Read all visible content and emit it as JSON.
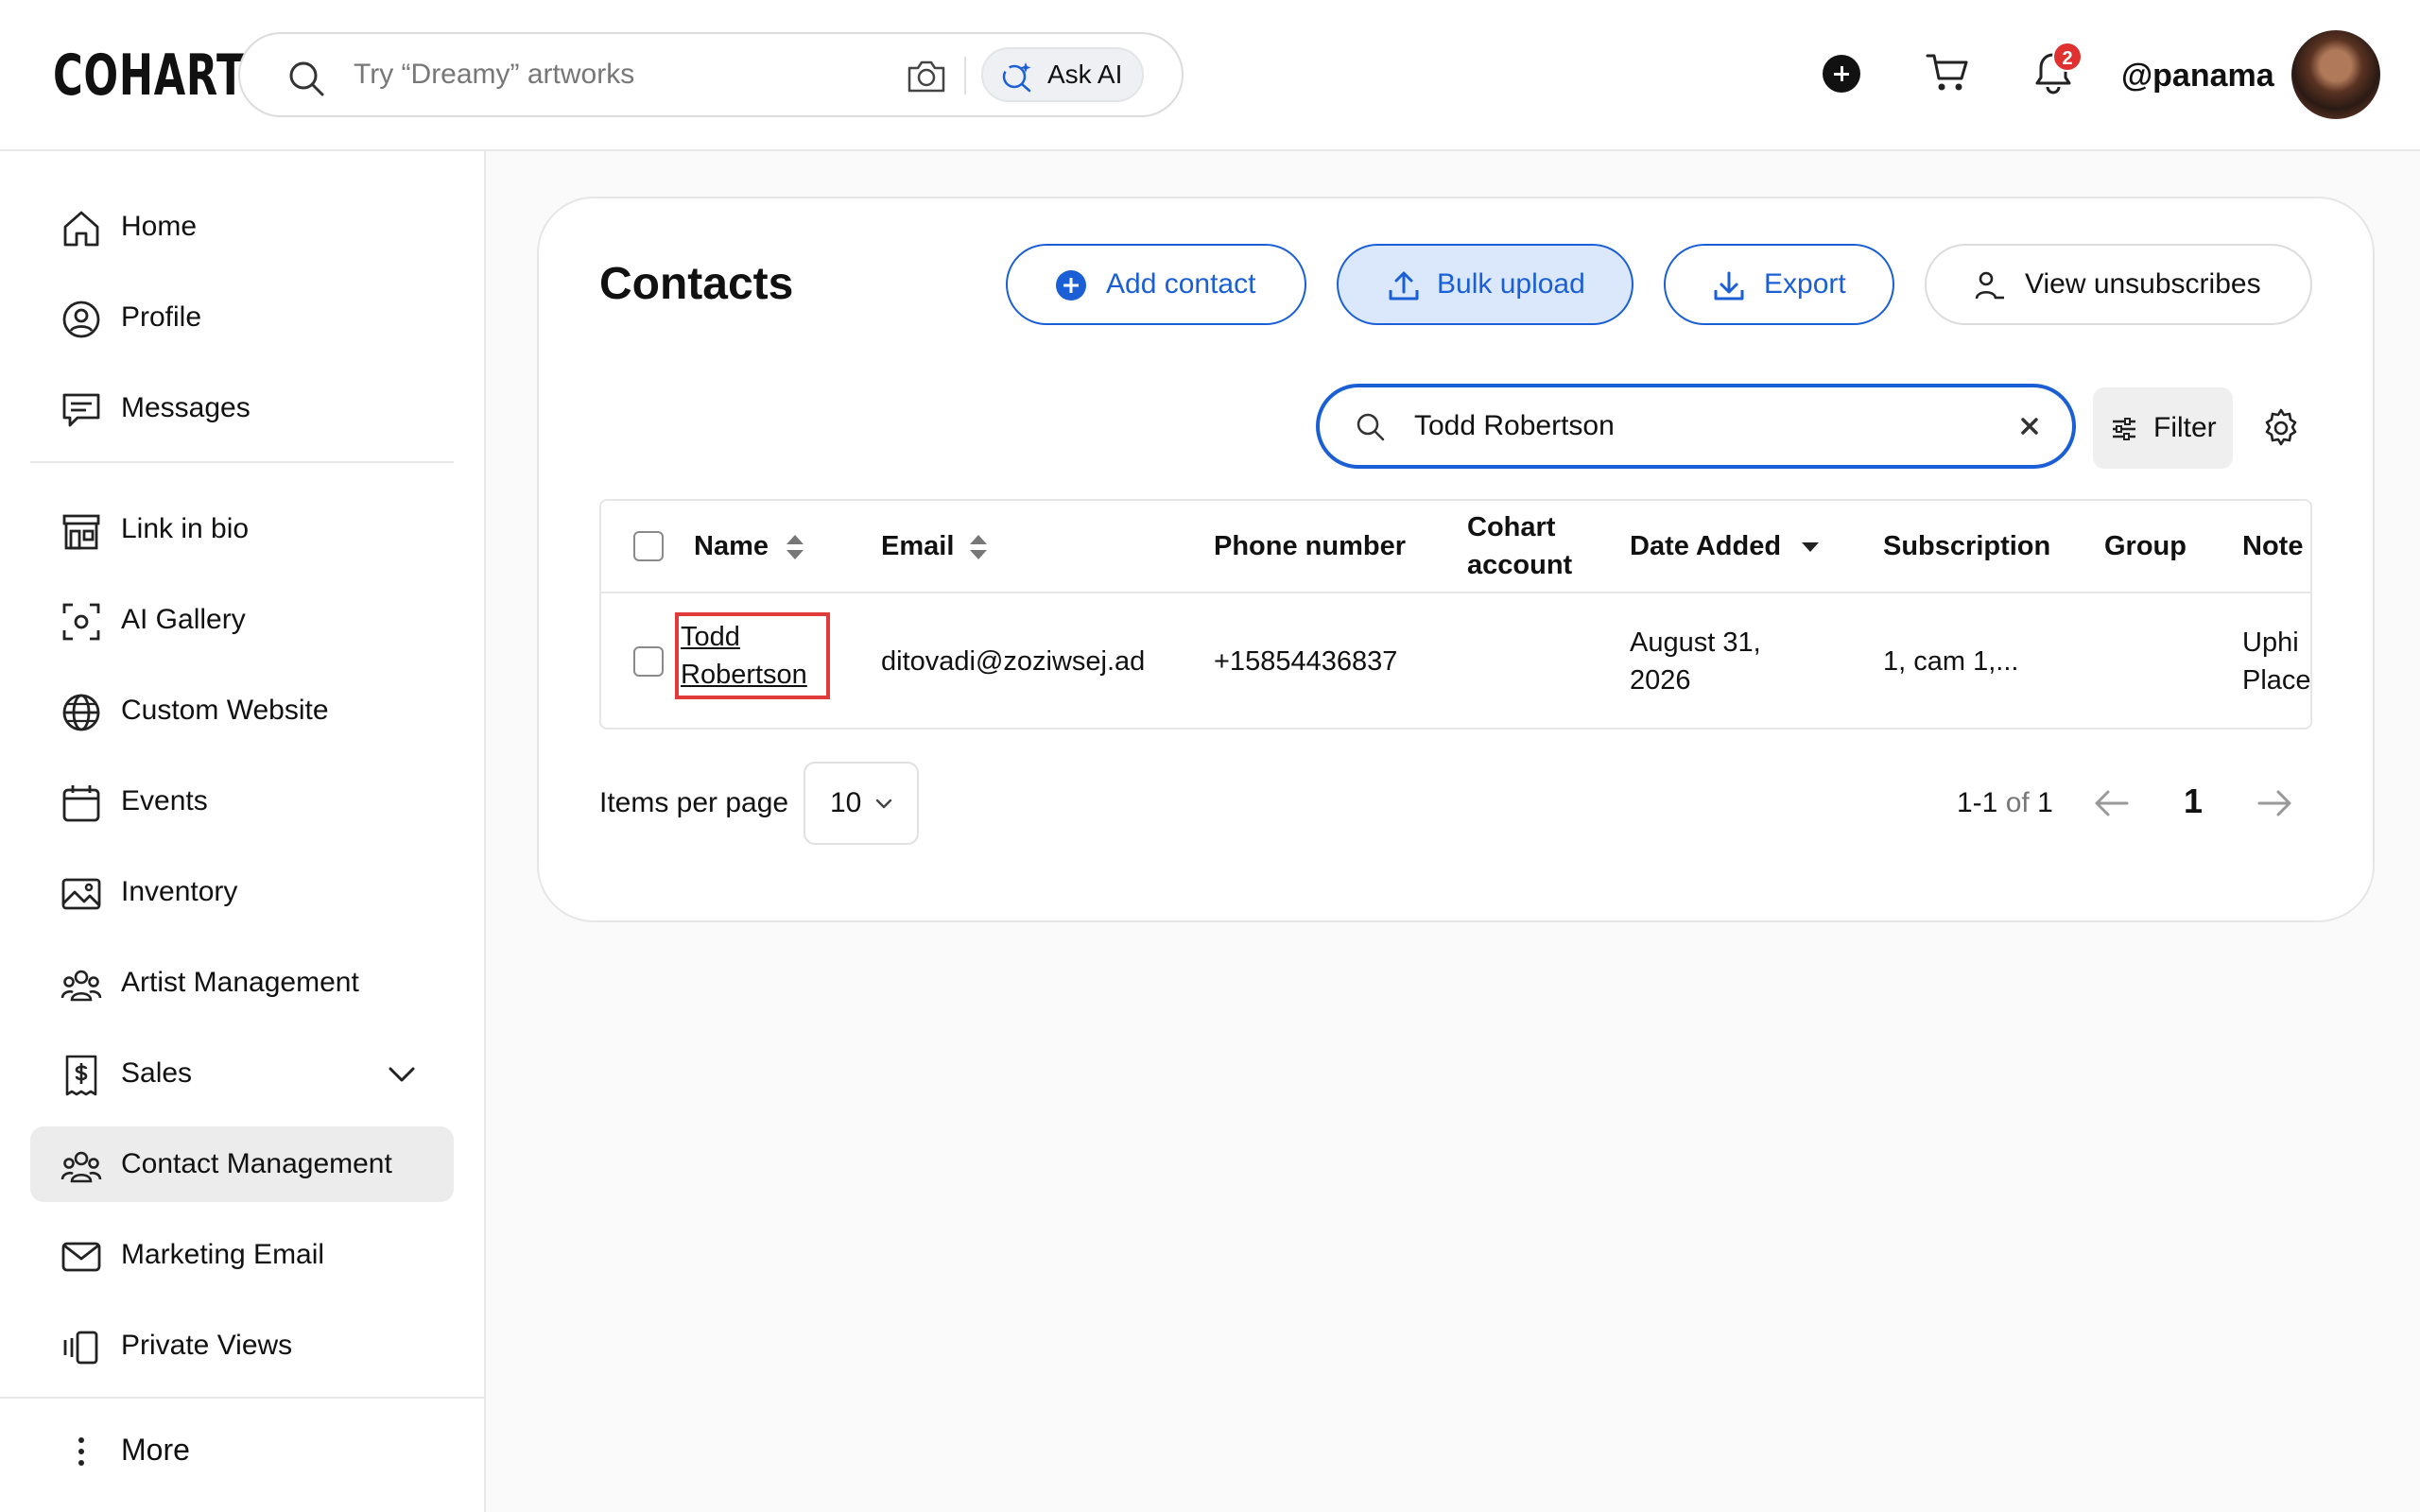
{
  "header": {
    "logo": "COHART",
    "search_placeholder": "Try “Dreamy” artworks",
    "ask_ai_label": "Ask AI",
    "notification_count": "2",
    "username": "@panama"
  },
  "sidebar": {
    "items": [
      {
        "label": "Home",
        "icon": "home-icon"
      },
      {
        "label": "Profile",
        "icon": "profile-icon"
      },
      {
        "label": "Messages",
        "icon": "messages-icon"
      },
      {
        "label": "Link in bio",
        "icon": "storefront-icon"
      },
      {
        "label": "AI Gallery",
        "icon": "ai-gallery-icon"
      },
      {
        "label": "Custom Website",
        "icon": "globe-icon"
      },
      {
        "label": "Events",
        "icon": "calendar-icon"
      },
      {
        "label": "Inventory",
        "icon": "image-icon"
      },
      {
        "label": "Artist Management",
        "icon": "people-icon"
      },
      {
        "label": "Sales",
        "icon": "dollar-icon"
      },
      {
        "label": "Contact Management",
        "icon": "people-icon",
        "active": true
      },
      {
        "label": "Marketing Email",
        "icon": "mail-icon"
      },
      {
        "label": "Private Views",
        "icon": "private-views-icon"
      }
    ],
    "more_label": "More"
  },
  "contacts": {
    "title": "Contacts",
    "add_contact": "Add contact",
    "bulk_upload": "Bulk upload",
    "export": "Export",
    "view_unsubscribes": "View unsubscribes",
    "search_value": "Todd Robertson",
    "filter_label": "Filter",
    "columns": {
      "name": "Name",
      "email": "Email",
      "phone": "Phone number",
      "cohart_line1": "Cohart",
      "cohart_line2": "account",
      "date_added": "Date Added",
      "subscription": "Subscription",
      "group": "Group",
      "note": "Note"
    },
    "rows": [
      {
        "name_line1": "Todd",
        "name_line2": "Robertson",
        "email": "ditovadi@zoziwsej.ad",
        "phone": "+15854436837",
        "cohart_account": "",
        "date_line1": "August 31,",
        "date_line2": "2026",
        "subscription": "1, cam 1,...",
        "group": "",
        "note_line1": "Uphi",
        "note_line2": "Place"
      }
    ]
  },
  "pagination": {
    "items_per_page_label": "Items per page",
    "items_per_page_value": "10",
    "range_start": "1-1",
    "range_of": "of",
    "range_total": "1",
    "current_page": "1"
  },
  "colors": {
    "accent": "#1a5fd6",
    "active_nav_bg": "#ececec",
    "highlight_outline": "#e03b3b",
    "badge": "#e03131"
  }
}
